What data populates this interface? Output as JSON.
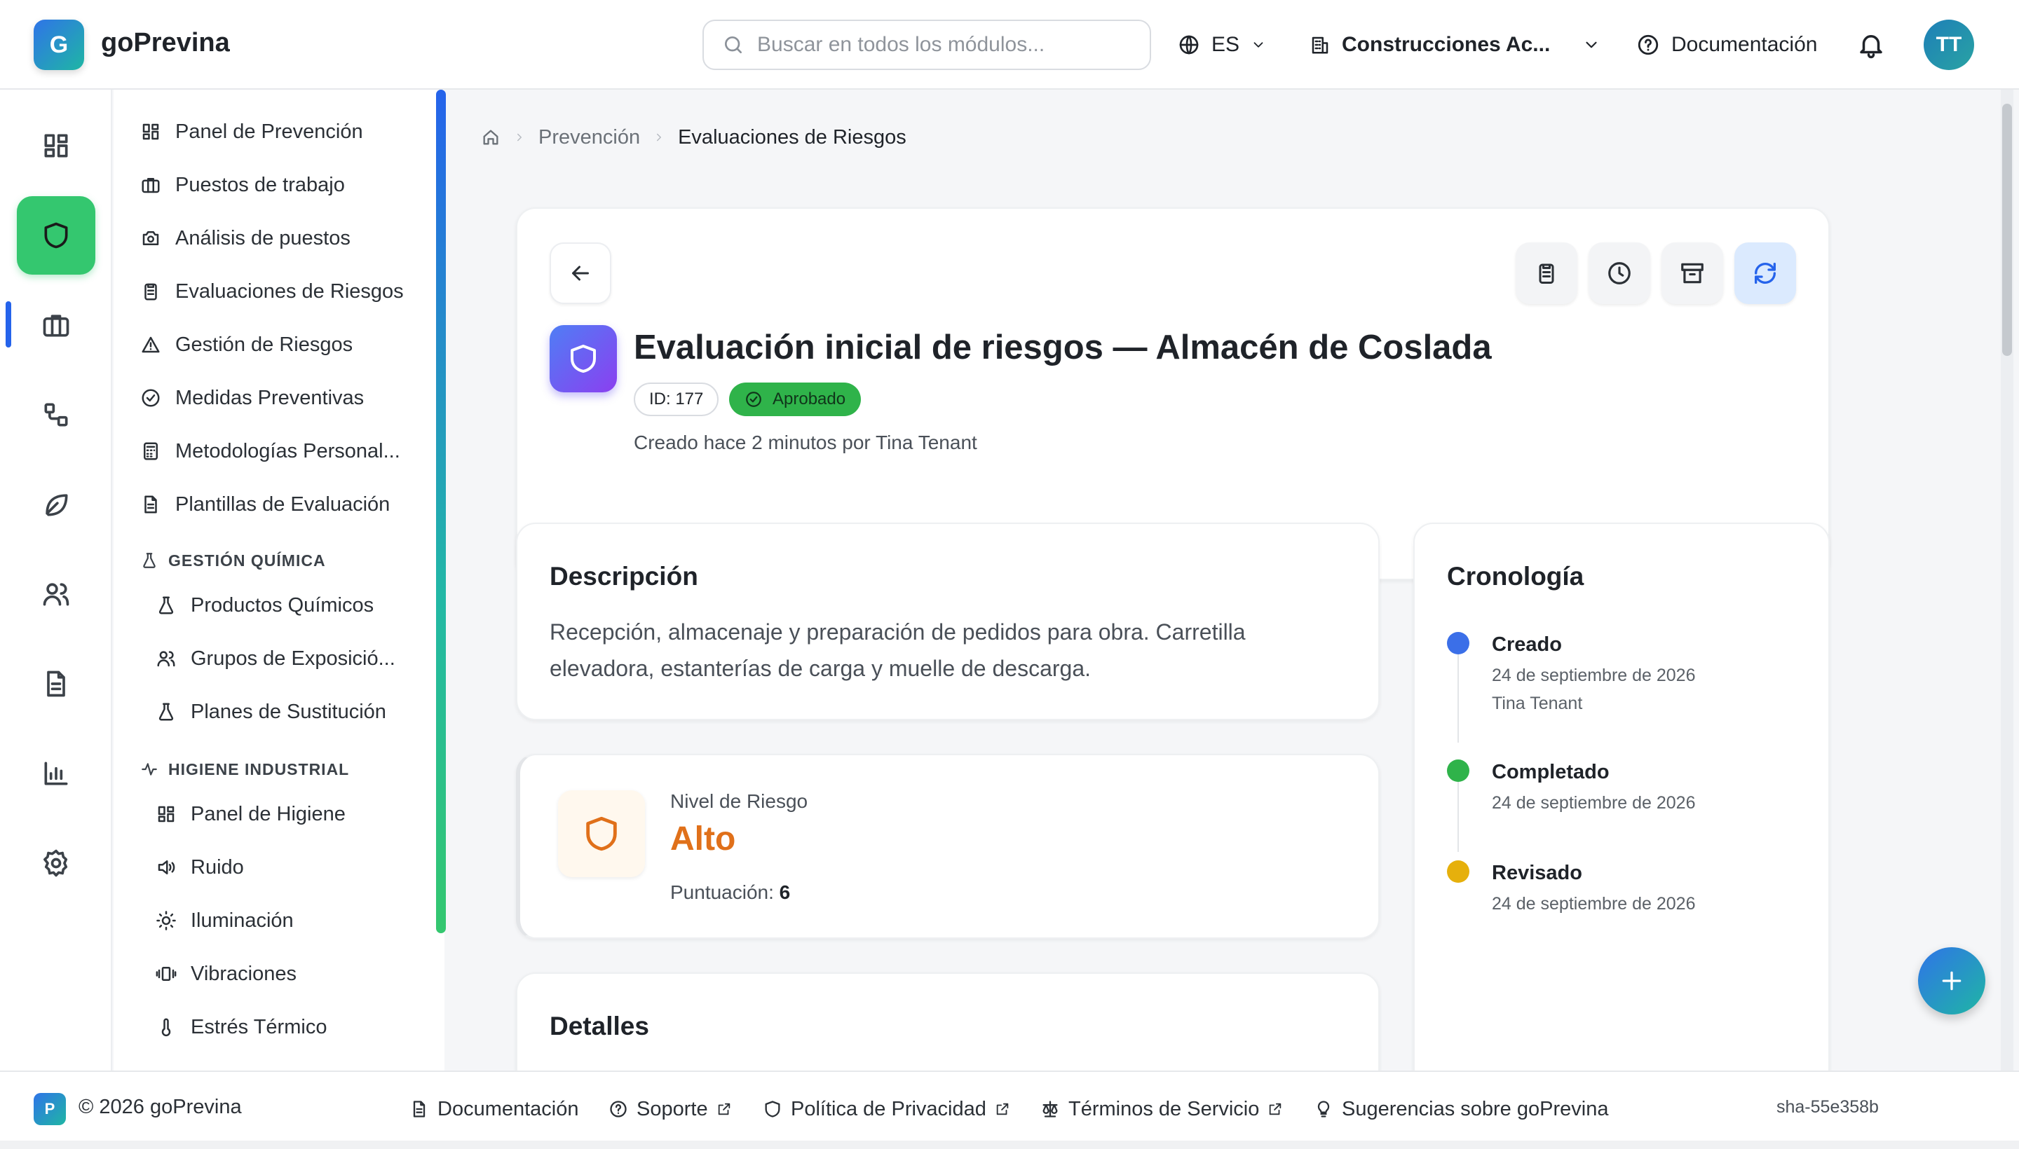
{
  "header": {
    "logo_letter": "G",
    "brand": "goPrevina",
    "search_placeholder": "Buscar en todos los módulos...",
    "language": "ES",
    "company": "Construcciones Ac...",
    "docs": "Documentación",
    "avatar_initials": "TT"
  },
  "rail": {
    "items": [
      "dashboard-icon",
      "shield-icon",
      "briefcase-icon",
      "workflow-icon",
      "leaf-icon",
      "users-icon",
      "document-icon",
      "chart-icon",
      "gear-icon"
    ],
    "active": "shield-icon"
  },
  "sidebar": {
    "items": [
      {
        "label": "Panel de Prevención",
        "icon": "dashboard-icon"
      },
      {
        "label": "Puestos de trabajo",
        "icon": "briefcase-icon"
      },
      {
        "label": "Análisis de puestos",
        "icon": "camera-icon"
      },
      {
        "label": "Evaluaciones de Riesgos",
        "icon": "clipboard-icon"
      },
      {
        "label": "Gestión de Riesgos",
        "icon": "warning-icon"
      },
      {
        "label": "Medidas Preventivas",
        "icon": "check-circle-icon"
      },
      {
        "label": "Metodologías Personal...",
        "icon": "calculator-icon"
      },
      {
        "label": "Plantillas de Evaluación",
        "icon": "file-icon"
      }
    ],
    "group_chem": {
      "title": "GESTIÓN QUÍMICA",
      "items": [
        {
          "label": "Productos Químicos",
          "icon": "flask-icon"
        },
        {
          "label": "Grupos de Exposició...",
          "icon": "users-icon"
        },
        {
          "label": "Planes de Sustitución",
          "icon": "flask-icon"
        }
      ]
    },
    "group_hyg": {
      "title": "HIGIENE INDUSTRIAL",
      "items": [
        {
          "label": "Panel de Higiene",
          "icon": "dashboard-icon"
        },
        {
          "label": "Ruido",
          "icon": "speaker-icon"
        },
        {
          "label": "Iluminación",
          "icon": "sun-icon"
        },
        {
          "label": "Vibraciones",
          "icon": "vibrate-icon"
        },
        {
          "label": "Estrés Térmico",
          "icon": "thermometer-icon"
        }
      ]
    }
  },
  "breadcrumb": {
    "section": "Prevención",
    "current": "Evaluaciones de Riesgos"
  },
  "record": {
    "title": "Evaluación inicial de riesgos — Almacén de Coslada",
    "id_label": "ID: 177",
    "status": "Aprobado",
    "created": "Creado hace 2 minutos por Tina Tenant"
  },
  "description": {
    "title": "Descripción",
    "text": "Recepción, almacenaje y preparación de pedidos para obra. Carretilla elevadora, estanterías de carga y muelle de descarga."
  },
  "risk": {
    "label": "Nivel de Riesgo",
    "value": "Alto",
    "score_label": "Puntuación:",
    "score": "6"
  },
  "details": {
    "title": "Detalles"
  },
  "timeline": {
    "title": "Cronología",
    "events": [
      {
        "title": "Creado",
        "date": "24 de septiembre de 2026",
        "by": "Tina Tenant",
        "color": "#3b6fe8"
      },
      {
        "title": "Completado",
        "date": "24 de septiembre de 2026",
        "color": "#2fb34a"
      },
      {
        "title": "Revisado",
        "date": "24 de septiembre de 2026",
        "color": "#e6b00c"
      }
    ]
  },
  "footer": {
    "logo_letter": "P",
    "copyright": "© 2026 goPrevina",
    "links": [
      "Documentación",
      "Soporte",
      "Política de Privacidad",
      "Términos de Servicio",
      "Sugerencias sobre goPrevina"
    ],
    "sha": "sha-55e358b"
  },
  "colors": {
    "accent": "#2563eb",
    "active_rail": "#34c76f",
    "status_approved": "#2fb34a",
    "risk_high": "#e0701a"
  }
}
